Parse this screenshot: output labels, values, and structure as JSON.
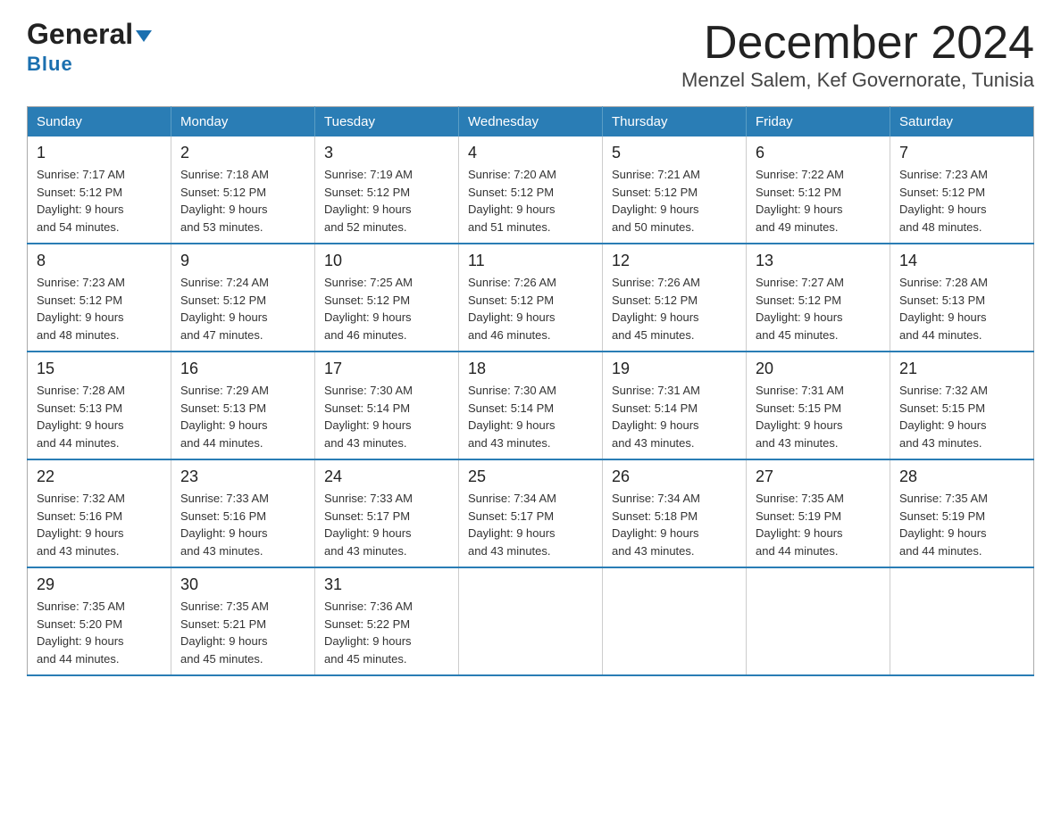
{
  "header": {
    "logo_general": "General",
    "logo_blue": "Blue",
    "month_title": "December 2024",
    "location": "Menzel Salem, Kef Governorate, Tunisia"
  },
  "weekdays": [
    "Sunday",
    "Monday",
    "Tuesday",
    "Wednesday",
    "Thursday",
    "Friday",
    "Saturday"
  ],
  "weeks": [
    [
      {
        "day": "1",
        "sunrise": "7:17 AM",
        "sunset": "5:12 PM",
        "daylight": "9 hours and 54 minutes."
      },
      {
        "day": "2",
        "sunrise": "7:18 AM",
        "sunset": "5:12 PM",
        "daylight": "9 hours and 53 minutes."
      },
      {
        "day": "3",
        "sunrise": "7:19 AM",
        "sunset": "5:12 PM",
        "daylight": "9 hours and 52 minutes."
      },
      {
        "day": "4",
        "sunrise": "7:20 AM",
        "sunset": "5:12 PM",
        "daylight": "9 hours and 51 minutes."
      },
      {
        "day": "5",
        "sunrise": "7:21 AM",
        "sunset": "5:12 PM",
        "daylight": "9 hours and 50 minutes."
      },
      {
        "day": "6",
        "sunrise": "7:22 AM",
        "sunset": "5:12 PM",
        "daylight": "9 hours and 49 minutes."
      },
      {
        "day": "7",
        "sunrise": "7:23 AM",
        "sunset": "5:12 PM",
        "daylight": "9 hours and 48 minutes."
      }
    ],
    [
      {
        "day": "8",
        "sunrise": "7:23 AM",
        "sunset": "5:12 PM",
        "daylight": "9 hours and 48 minutes."
      },
      {
        "day": "9",
        "sunrise": "7:24 AM",
        "sunset": "5:12 PM",
        "daylight": "9 hours and 47 minutes."
      },
      {
        "day": "10",
        "sunrise": "7:25 AM",
        "sunset": "5:12 PM",
        "daylight": "9 hours and 46 minutes."
      },
      {
        "day": "11",
        "sunrise": "7:26 AM",
        "sunset": "5:12 PM",
        "daylight": "9 hours and 46 minutes."
      },
      {
        "day": "12",
        "sunrise": "7:26 AM",
        "sunset": "5:12 PM",
        "daylight": "9 hours and 45 minutes."
      },
      {
        "day": "13",
        "sunrise": "7:27 AM",
        "sunset": "5:12 PM",
        "daylight": "9 hours and 45 minutes."
      },
      {
        "day": "14",
        "sunrise": "7:28 AM",
        "sunset": "5:13 PM",
        "daylight": "9 hours and 44 minutes."
      }
    ],
    [
      {
        "day": "15",
        "sunrise": "7:28 AM",
        "sunset": "5:13 PM",
        "daylight": "9 hours and 44 minutes."
      },
      {
        "day": "16",
        "sunrise": "7:29 AM",
        "sunset": "5:13 PM",
        "daylight": "9 hours and 44 minutes."
      },
      {
        "day": "17",
        "sunrise": "7:30 AM",
        "sunset": "5:14 PM",
        "daylight": "9 hours and 43 minutes."
      },
      {
        "day": "18",
        "sunrise": "7:30 AM",
        "sunset": "5:14 PM",
        "daylight": "9 hours and 43 minutes."
      },
      {
        "day": "19",
        "sunrise": "7:31 AM",
        "sunset": "5:14 PM",
        "daylight": "9 hours and 43 minutes."
      },
      {
        "day": "20",
        "sunrise": "7:31 AM",
        "sunset": "5:15 PM",
        "daylight": "9 hours and 43 minutes."
      },
      {
        "day": "21",
        "sunrise": "7:32 AM",
        "sunset": "5:15 PM",
        "daylight": "9 hours and 43 minutes."
      }
    ],
    [
      {
        "day": "22",
        "sunrise": "7:32 AM",
        "sunset": "5:16 PM",
        "daylight": "9 hours and 43 minutes."
      },
      {
        "day": "23",
        "sunrise": "7:33 AM",
        "sunset": "5:16 PM",
        "daylight": "9 hours and 43 minutes."
      },
      {
        "day": "24",
        "sunrise": "7:33 AM",
        "sunset": "5:17 PM",
        "daylight": "9 hours and 43 minutes."
      },
      {
        "day": "25",
        "sunrise": "7:34 AM",
        "sunset": "5:17 PM",
        "daylight": "9 hours and 43 minutes."
      },
      {
        "day": "26",
        "sunrise": "7:34 AM",
        "sunset": "5:18 PM",
        "daylight": "9 hours and 43 minutes."
      },
      {
        "day": "27",
        "sunrise": "7:35 AM",
        "sunset": "5:19 PM",
        "daylight": "9 hours and 44 minutes."
      },
      {
        "day": "28",
        "sunrise": "7:35 AM",
        "sunset": "5:19 PM",
        "daylight": "9 hours and 44 minutes."
      }
    ],
    [
      {
        "day": "29",
        "sunrise": "7:35 AM",
        "sunset": "5:20 PM",
        "daylight": "9 hours and 44 minutes."
      },
      {
        "day": "30",
        "sunrise": "7:35 AM",
        "sunset": "5:21 PM",
        "daylight": "9 hours and 45 minutes."
      },
      {
        "day": "31",
        "sunrise": "7:36 AM",
        "sunset": "5:22 PM",
        "daylight": "9 hours and 45 minutes."
      },
      null,
      null,
      null,
      null
    ]
  ],
  "labels": {
    "sunrise": "Sunrise:",
    "sunset": "Sunset:",
    "daylight": "Daylight:"
  }
}
